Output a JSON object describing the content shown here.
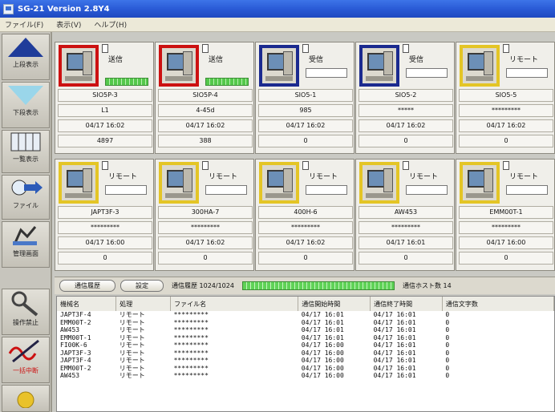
{
  "app": {
    "title": "SG-21 Version 2.8Y4"
  },
  "menu": [
    "ファイル(F)",
    "表示(V)",
    "ヘルプ(H)"
  ],
  "sidebar": [
    {
      "label": "上段表示",
      "icon": "up-triangle-icon"
    },
    {
      "label": "下段表示",
      "icon": "down-triangle-icon"
    },
    {
      "label": "一覧表示",
      "icon": "list-view-icon"
    },
    {
      "label": "ファイル",
      "icon": "file-transfer-icon"
    },
    {
      "label": "管理画面",
      "icon": "manage-icon"
    },
    {
      "label": "操作禁止",
      "icon": "lock-key-icon"
    },
    {
      "label": "一括中断",
      "icon": "interrupt-icon"
    }
  ],
  "cards": [
    {
      "color": "red",
      "mode": "送信",
      "progress": true,
      "name": "SIO5P-3",
      "file": "L1",
      "date": "04/17 16:02",
      "count": "4897"
    },
    {
      "color": "red",
      "mode": "送信",
      "progress": true,
      "name": "SIO5P-4",
      "file": "4-45d",
      "date": "04/17 16:02",
      "count": "388"
    },
    {
      "color": "blue",
      "mode": "受信",
      "progress": false,
      "name": "SIO5-1",
      "file": "985",
      "date": "04/17 16:02",
      "count": "0"
    },
    {
      "color": "blue",
      "mode": "受信",
      "progress": false,
      "name": "SIO5-2",
      "file": "*****",
      "date": "04/17 16:02",
      "count": "0"
    },
    {
      "color": "yellow",
      "mode": "リモート",
      "progress": false,
      "name": "SIO5-5",
      "file": "*********",
      "date": "04/17 16:02",
      "count": "0"
    },
    {
      "color": "yellow",
      "mode": "リモート",
      "progress": false,
      "name": "JAPT3F-3",
      "file": "*********",
      "date": "04/17 16:00",
      "count": "0"
    },
    {
      "color": "yellow",
      "mode": "リモート",
      "progress": false,
      "name": "300HA-7",
      "file": "*********",
      "date": "04/17 16:02",
      "count": "0"
    },
    {
      "color": "yellow",
      "mode": "リモート",
      "progress": false,
      "name": "400H-6",
      "file": "*********",
      "date": "04/17 16:02",
      "count": "0"
    },
    {
      "color": "yellow",
      "mode": "リモート",
      "progress": false,
      "name": "AW453",
      "file": "*********",
      "date": "04/17 16:01",
      "count": "0"
    },
    {
      "color": "yellow",
      "mode": "リモート",
      "progress": false,
      "name": "EMM00T-1",
      "file": "*********",
      "date": "04/17 16:00",
      "count": "0"
    }
  ],
  "tabs": {
    "history": "通信履歴",
    "settings": "設定"
  },
  "status": {
    "history_label": "通信履歴 1024/1024",
    "host_label": "通信ホスト数 14"
  },
  "log": {
    "columns": [
      "機械名",
      "処理",
      "ファイル名",
      "通信開始時間",
      "通信終了時間",
      "通信文字数"
    ],
    "rows": [
      [
        "JAPT3F-4",
        "リモート",
        "*********",
        "04/17 16:01",
        "04/17 16:01",
        "0"
      ],
      [
        "EMM00T-2",
        "リモート",
        "*********",
        "04/17 16:01",
        "04/17 16:01",
        "0"
      ],
      [
        "AW453",
        "リモート",
        "*********",
        "04/17 16:01",
        "04/17 16:01",
        "0"
      ],
      [
        "EMM00T-1",
        "リモート",
        "*********",
        "04/17 16:01",
        "04/17 16:01",
        "0"
      ],
      [
        "FI00K-6",
        "リモート",
        "*********",
        "04/17 16:00",
        "04/17 16:01",
        "0"
      ],
      [
        "JAPT3F-3",
        "リモート",
        "*********",
        "04/17 16:00",
        "04/17 16:01",
        "0"
      ],
      [
        "JAPT3F-4",
        "リモート",
        "*********",
        "04/17 16:00",
        "04/17 16:01",
        "0"
      ],
      [
        "EMM00T-2",
        "リモート",
        "*********",
        "04/17 16:00",
        "04/17 16:01",
        "0"
      ],
      [
        "AW453",
        "リモート",
        "*********",
        "04/17 16:00",
        "04/17 16:01",
        "0"
      ]
    ]
  }
}
